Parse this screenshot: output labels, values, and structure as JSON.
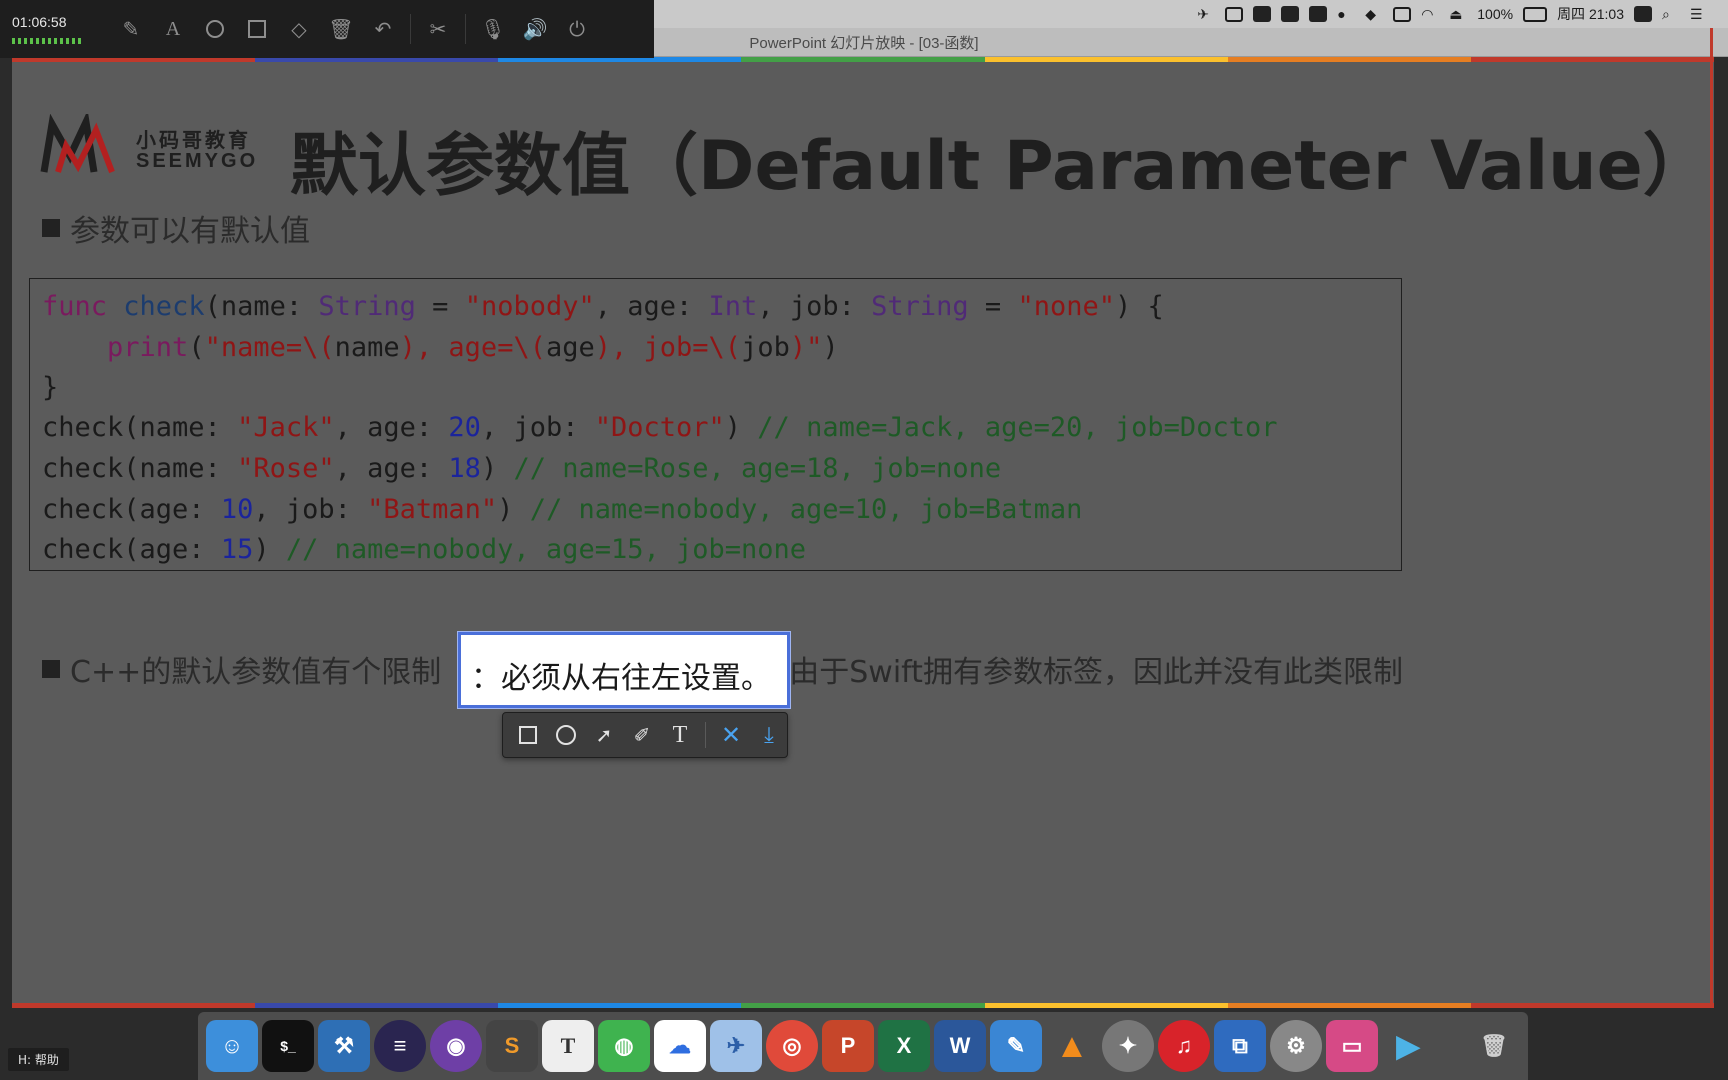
{
  "recording": {
    "elapsed": "01:06:58",
    "tools": [
      "pen-icon",
      "text-icon",
      "circle-icon",
      "rectangle-icon",
      "eraser-icon",
      "trash-icon",
      "undo-icon",
      "scissors-icon",
      "microphone-icon",
      "speaker-icon",
      "power-icon"
    ]
  },
  "menubar": {
    "battery": "100%",
    "clock": "周四 21:03"
  },
  "window": {
    "title": "PowerPoint 幻灯片放映 - [03-函数]"
  },
  "slide": {
    "logo": {
      "cn": "小码哥教育",
      "en": "SEEMYGO"
    },
    "title": "默认参数值（Default Parameter Value）",
    "bullet1": "参数可以有默认值",
    "code": {
      "l1": {
        "kw": "func",
        "fn": "check",
        "p1": "(name: ",
        "t1": "String",
        "p2": " = ",
        "s1": "\"nobody\"",
        "p3": ", age: ",
        "t2": "Int",
        "p4": ", job: ",
        "t3": "String",
        "p5": " = ",
        "s2": "\"none\"",
        "p6": ") {"
      },
      "l2": {
        "indent": "    ",
        "fn": "print",
        "p1": "(",
        "s1": "\"name=\\(",
        "p2": "name",
        "s2": "), age=\\(",
        "p3": "age",
        "s3": "), job=\\(",
        "p4": "job",
        "s4": ")\"",
        "p5": ")"
      },
      "l3": "}",
      "l4": {
        "p1": "check(name: ",
        "s1": "\"Jack\"",
        "p2": ", age: ",
        "n1": "20",
        "p3": ", job: ",
        "s2": "\"Doctor\"",
        "p4": ") ",
        "cm": "// name=Jack, age=20, job=Doctor"
      },
      "l5": {
        "p1": "check(name: ",
        "s1": "\"Rose\"",
        "p2": ", age: ",
        "n1": "18",
        "p3": ") ",
        "cm": "// name=Rose, age=18, job=none"
      },
      "l6": {
        "p1": "check(age: ",
        "n1": "10",
        "p2": ", job: ",
        "s1": "\"Batman\"",
        "p3": ") ",
        "cm": "// name=nobody, age=10, job=Batman"
      },
      "l7": {
        "p1": "check(age: ",
        "n1": "15",
        "p2": ") ",
        "cm": "// name=nobody, age=15, job=none"
      }
    },
    "bullet2_before": "C++的默认参数值有个限制",
    "bullet2_after": "由于Swift拥有参数标签，因此并没有此类限制"
  },
  "selection": {
    "text": "：必须从右往左设置。"
  },
  "snap_toolbar": {
    "tools": [
      "rectangle-tool-icon",
      "ellipse-tool-icon",
      "arrow-tool-icon",
      "brush-tool-icon",
      "text-tool-icon",
      "cancel-icon",
      "download-icon"
    ]
  },
  "help": {
    "label": "H: 帮助"
  },
  "colors": {
    "rainbow": [
      "#c0392b",
      "#3949ab",
      "#1e88e5",
      "#43a047",
      "#fbc02d",
      "#e67e22",
      "#c0392b"
    ]
  }
}
